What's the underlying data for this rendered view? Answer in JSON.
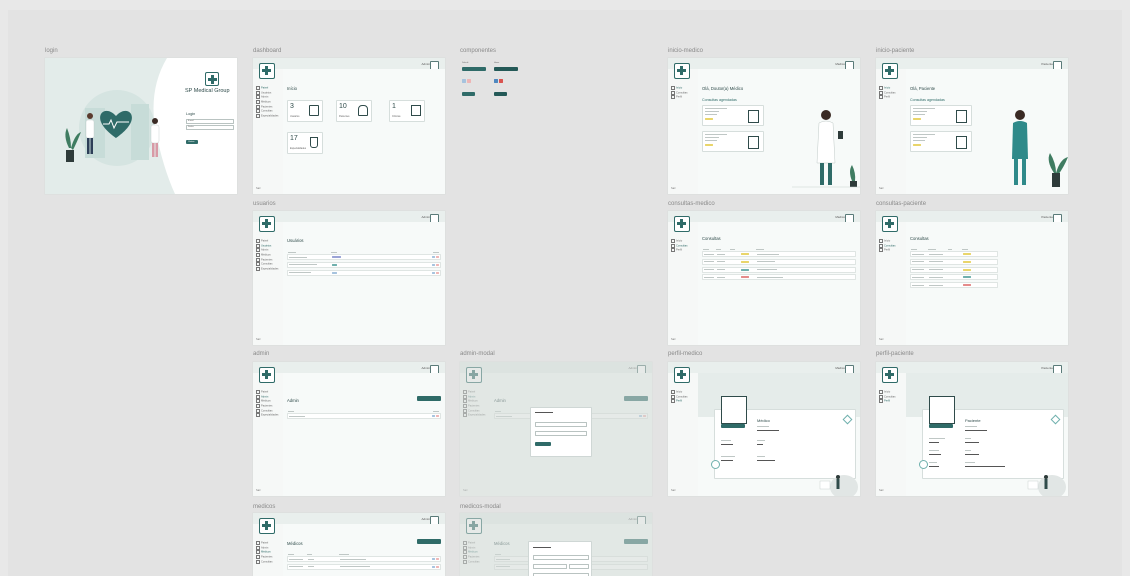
{
  "frames": {
    "login": "login",
    "dashboard": "dashboard",
    "componentes": "componentes",
    "inicio_medico": "inicio-medico",
    "inicio_paciente": "inicio-paciente",
    "usuarios": "usuarios",
    "consultas_medico": "consultas-medico",
    "consultas_paciente": "consultas-paciente",
    "admin": "admin",
    "admin_modal": "admin-modal",
    "perfil_medico": "perfil-medico",
    "perfil_paciente": "perfil-paciente",
    "medicos": "medicos",
    "medicos_modal": "medicos-modal"
  },
  "login": {
    "brand": "SP Medical Group",
    "heading": "Login",
    "email_placeholder": "E-mail",
    "password_placeholder": "Senha",
    "submit": "Entrar"
  },
  "dashboard": {
    "title": "Início",
    "stats": [
      {
        "value": "3",
        "label": "Usuários"
      },
      {
        "value": "10",
        "label": "Pacientes"
      },
      {
        "value": "1",
        "label": "Clínicas"
      },
      {
        "value": "17",
        "label": "Especialidades"
      }
    ]
  },
  "usuarios": {
    "title": "Usuários"
  },
  "admin": {
    "title": "Admin"
  },
  "medicos": {
    "title": "Médicos"
  },
  "inicio_medico": {
    "title": "Olá, Doutor(a) Médico",
    "subtitle": "Consultas agendadas"
  },
  "inicio_paciente": {
    "title": "Olá, Paciente",
    "subtitle": "Consultas agendadas"
  },
  "consultas_medico": {
    "title": "Consultas"
  },
  "consultas_paciente": {
    "title": "Consultas"
  },
  "perfil_medico": {
    "name": "Médico"
  },
  "perfil_paciente": {
    "name": "Paciente"
  },
  "sidebar": {
    "exit": "Sair"
  },
  "colors": {
    "accent": "#2f6b68",
    "status_yellow": "#e9d56a",
    "status_teal": "#6fb0ad",
    "status_red": "#e58b8b",
    "status_purple": "#9aa3d6"
  }
}
